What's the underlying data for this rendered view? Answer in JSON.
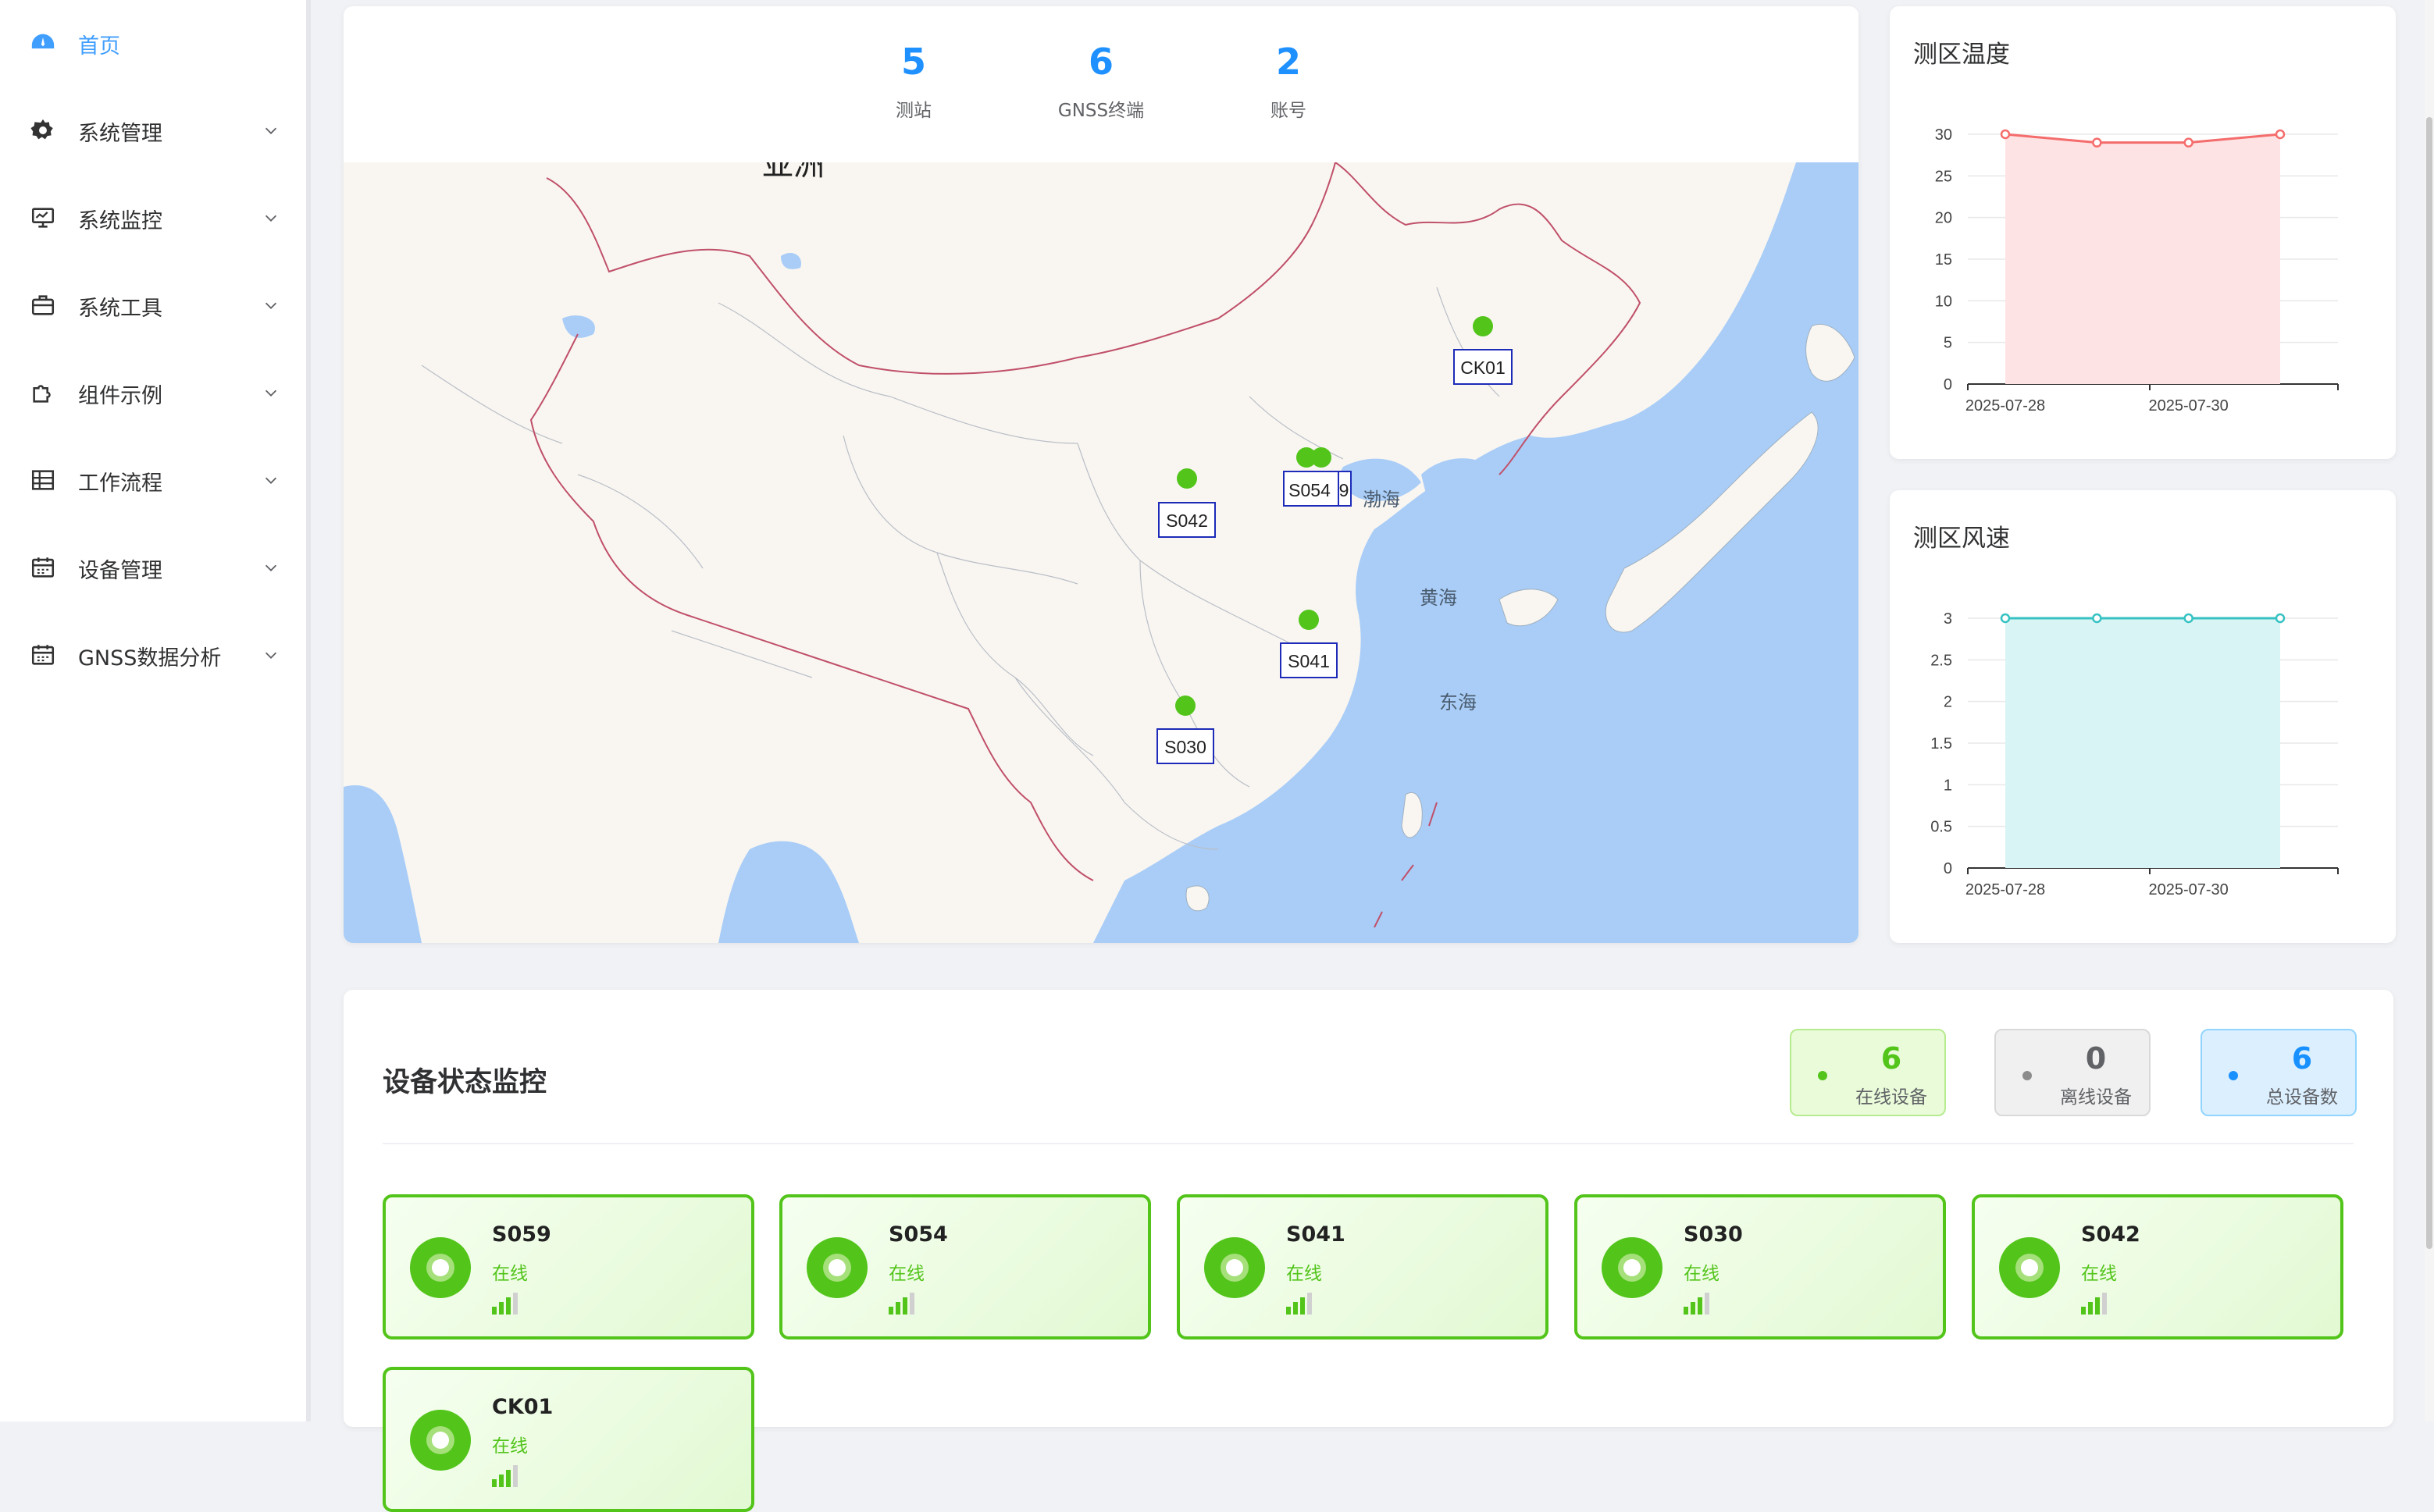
{
  "sidebar": {
    "items": [
      {
        "label": "首页",
        "icon": "dashboard-icon",
        "active": true
      },
      {
        "label": "系统管理",
        "icon": "gear-icon"
      },
      {
        "label": "系统监控",
        "icon": "monitor-icon"
      },
      {
        "label": "系统工具",
        "icon": "toolbox-icon"
      },
      {
        "label": "组件示例",
        "icon": "puzzle-icon"
      },
      {
        "label": "工作流程",
        "icon": "table-icon"
      },
      {
        "label": "设备管理",
        "icon": "calendar-icon"
      },
      {
        "label": "GNSS数据分析",
        "icon": "calendar-icon"
      }
    ]
  },
  "stats": [
    {
      "value": "5",
      "label": "测站"
    },
    {
      "value": "6",
      "label": "GNSS终端"
    },
    {
      "value": "2",
      "label": "账号"
    }
  ],
  "map": {
    "labels": {
      "continent": "亚洲",
      "bohai": "渤海",
      "yellow_sea": "黄海",
      "east_sea": "东海"
    },
    "markers": [
      {
        "name": "CK01"
      },
      {
        "name": "S054",
        "overlap_suffix": "9"
      },
      {
        "name": "S042"
      },
      {
        "name": "S041"
      },
      {
        "name": "S030"
      }
    ],
    "colors": {
      "land": "#f9f6f1",
      "sea": "#a9cdf7",
      "marker": "#52c41a",
      "border": "#c0506a"
    }
  },
  "temp_chart": {
    "title": "测区温度",
    "color": "#f56c6c",
    "fill": "#fde3e4",
    "chart_data": {
      "type": "area",
      "x": [
        "2025-07-28",
        "2025-07-29",
        "2025-07-30",
        "2025-07-31"
      ],
      "series": [
        {
          "values": [
            30,
            29,
            29,
            30
          ]
        }
      ],
      "xtick_labels": [
        "2025-07-28",
        "2025-07-30"
      ],
      "yticks": [
        "0",
        "5",
        "10",
        "15",
        "20",
        "25",
        "30"
      ],
      "ylim": [
        0,
        30
      ],
      "grid": true
    }
  },
  "wind_chart": {
    "title": "测区风速",
    "color": "#36c2c2",
    "fill": "#d9f4f4",
    "chart_data": {
      "type": "area",
      "x": [
        "2025-07-28",
        "2025-07-29",
        "2025-07-30",
        "2025-07-31"
      ],
      "series": [
        {
          "values": [
            3,
            3,
            3,
            3
          ]
        }
      ],
      "xtick_labels": [
        "2025-07-28",
        "2025-07-30"
      ],
      "yticks": [
        "0",
        "0.5",
        "1",
        "1.5",
        "2",
        "2.5",
        "3"
      ],
      "ylim": [
        0,
        3
      ],
      "grid": true
    }
  },
  "monitor": {
    "title": "设备状态监控",
    "badges": [
      {
        "value": "6",
        "label": "在线设备",
        "color": "#52c41a"
      },
      {
        "value": "0",
        "label": "离线设备",
        "color": "#606266"
      },
      {
        "value": "6",
        "label": "总设备数",
        "color": "#1890ff"
      }
    ],
    "devices": [
      {
        "name": "S059",
        "status": "在线"
      },
      {
        "name": "S054",
        "status": "在线"
      },
      {
        "name": "S041",
        "status": "在线"
      },
      {
        "name": "S030",
        "status": "在线"
      },
      {
        "name": "S042",
        "status": "在线"
      },
      {
        "name": "CK01",
        "status": "在线"
      }
    ]
  }
}
